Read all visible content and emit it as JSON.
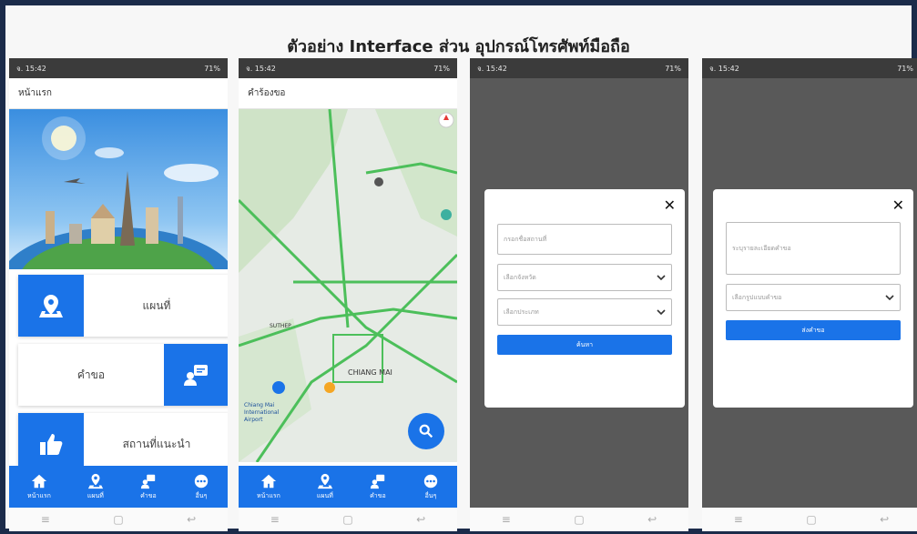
{
  "slide": {
    "title": "ตัวอย่าง Interface ส่วน อุปกรณ์โทรศัพท์มือถือ"
  },
  "status_bar": {
    "time": "จ. 15:42",
    "right": "71%"
  },
  "phone1": {
    "appbar_title": "หน้าแรก",
    "menu": [
      {
        "label": "แผนที่",
        "icon": "map-pin-icon"
      },
      {
        "label": "คำขอ",
        "icon": "request-icon"
      },
      {
        "label": "สถานที่แนะนำ",
        "icon": "thumbs-up-icon"
      }
    ]
  },
  "phone2": {
    "appbar_title": "คำร้องขอ",
    "map_labels": {
      "chiang_mai": "CHIANG MAI",
      "airport": "Chiang Mai International Airport",
      "suthep": "SUTHEP"
    }
  },
  "phone3": {
    "name_placeholder": "กรอกชื่อสถานที่",
    "province_select": "เลือกจังหวัด",
    "category_select": "เลือกประเภท",
    "submit_label": "ค้นหา"
  },
  "phone4": {
    "detail_placeholder": "ระบุรายละเอียดคำขอ",
    "type_select": "เลือกรูปแบบคำขอ",
    "submit_label": "ส่งคำขอ"
  },
  "bottom_nav": [
    {
      "label": "หน้าแรก",
      "icon": "home-icon"
    },
    {
      "label": "แผนที่",
      "icon": "map-pin-icon"
    },
    {
      "label": "คำขอ",
      "icon": "request-icon"
    },
    {
      "label": "อื่นๆ",
      "icon": "more-icon"
    }
  ],
  "colors": {
    "primary": "#1a73e8",
    "frame": "#1b2b4a",
    "overlay": "#595959"
  }
}
